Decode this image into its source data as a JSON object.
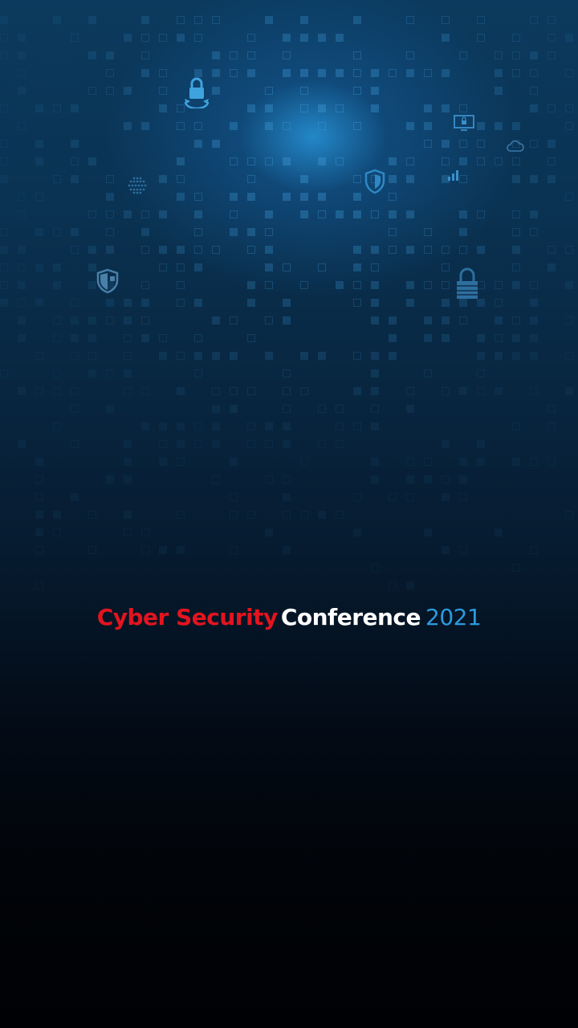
{
  "title": {
    "part1": "Cyber Security",
    "part2": "Conference",
    "year": "2021"
  },
  "colors": {
    "red": "#e3141e",
    "white": "#ffffff",
    "blue": "#2a9be0",
    "background_top": "#0b3a5e",
    "background_bottom": "#000104",
    "glow": "#2896dc"
  },
  "icons": [
    "padlock-refresh-icon",
    "shield-icon",
    "shield-check-icon",
    "padlock-icon",
    "monitor-lock-icon",
    "cloud-icon",
    "signal-bars-icon",
    "globe-dots-icon"
  ]
}
